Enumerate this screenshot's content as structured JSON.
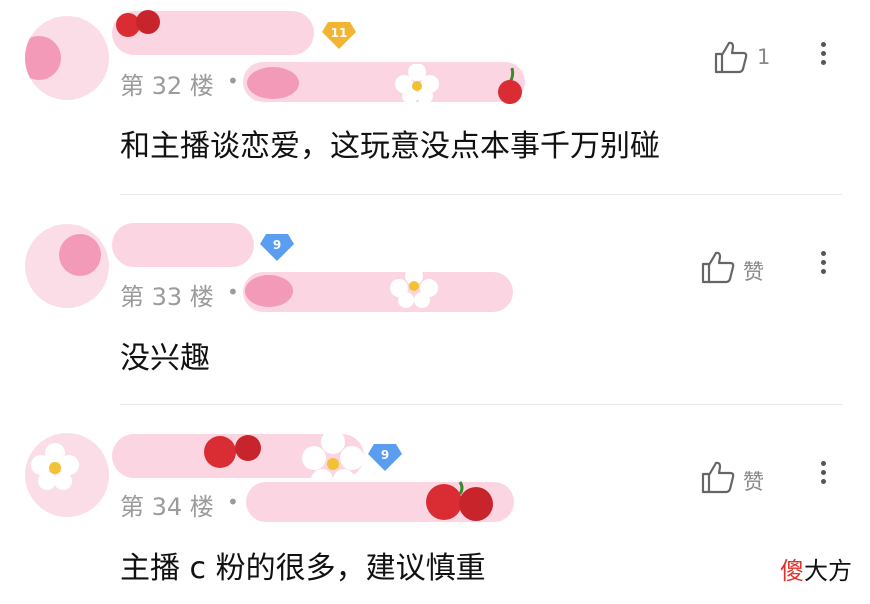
{
  "comments": [
    {
      "floor": "第 32 楼",
      "level": "11",
      "level_color": "#f2b531",
      "content": "和主播谈恋爱，这玩意没点本事千万别碰",
      "like_text": "1"
    },
    {
      "floor": "第 33 楼",
      "level": "9",
      "level_color": "#5b9df0",
      "content": "没兴趣",
      "like_text": "赞"
    },
    {
      "floor": "第 34 楼",
      "level": "9",
      "level_color": "#5b9df0",
      "content": "主播 c 粉的很多，建议慎重",
      "like_text": "赞"
    }
  ],
  "separator_dot": "•",
  "watermark": {
    "part1": "傻",
    "part2": "大方"
  },
  "colors": {
    "pink": "#fbd6e2",
    "cherry": "#d92d33",
    "muted_text": "#9b9b9b"
  },
  "icons": {
    "like": "thumbs-up-icon",
    "more": "more-vertical-icon"
  }
}
